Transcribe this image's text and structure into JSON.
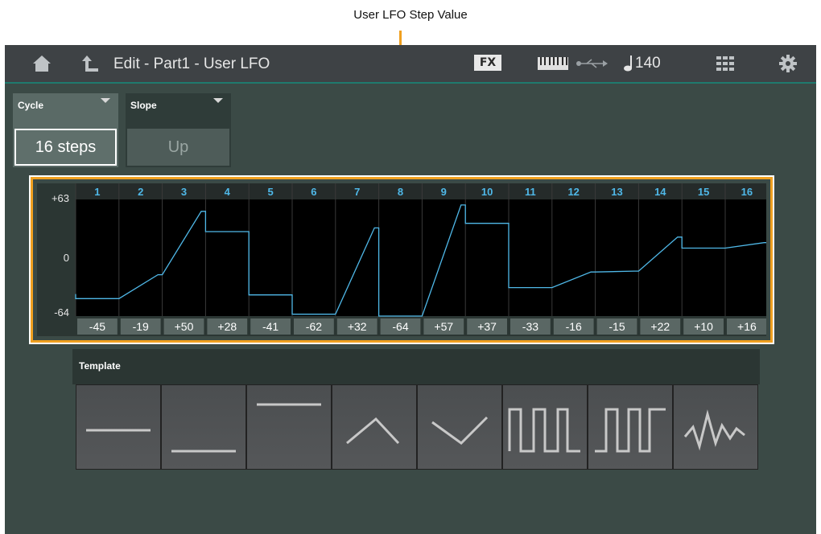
{
  "annotation": {
    "title": "User LFO Step Value"
  },
  "header": {
    "breadcrumb": "Edit - Part1 - User LFO",
    "fx_label": "FX",
    "tempo": "140"
  },
  "params": {
    "cycle": {
      "label": "Cycle",
      "value": "16 steps"
    },
    "slope": {
      "label": "Slope",
      "value": "Up"
    }
  },
  "graph": {
    "y_labels": [
      "+63",
      "0",
      "-64"
    ],
    "steps": [
      "1",
      "2",
      "3",
      "4",
      "5",
      "6",
      "7",
      "8",
      "9",
      "10",
      "11",
      "12",
      "13",
      "14",
      "15",
      "16"
    ],
    "value_labels": [
      "-45",
      "-19",
      "+50",
      "+28",
      "-41",
      "-62",
      "+32",
      "-64",
      "+57",
      "+37",
      "-33",
      "-16",
      "-15",
      "+22",
      "+10",
      "+16"
    ],
    "values": [
      -45,
      -19,
      50,
      28,
      -41,
      -62,
      32,
      -64,
      57,
      37,
      -33,
      -16,
      -15,
      22,
      10,
      16
    ],
    "line_color": "#4fb8e8",
    "step_number_color": "#4fb8e8"
  },
  "template": {
    "label": "Template",
    "items": [
      "flat-middle",
      "flat-low",
      "flat-high",
      "triangle-up",
      "triangle-down",
      "square-a",
      "square-b",
      "random"
    ]
  },
  "colors": {
    "highlight": "#f0a020",
    "accent": "#1f7a6e"
  }
}
